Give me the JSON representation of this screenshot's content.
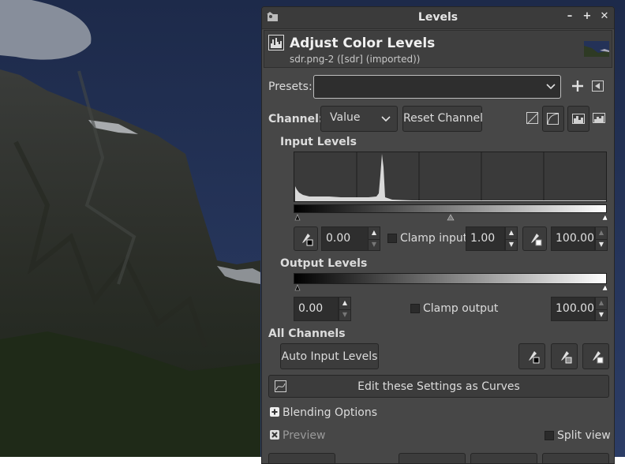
{
  "window": {
    "title": "Levels"
  },
  "header": {
    "title": "Adjust Color Levels",
    "subtitle": "sdr.png-2 ([sdr] (imported))"
  },
  "presets": {
    "label": "Presets:",
    "value": ""
  },
  "channel": {
    "label": "Channel:",
    "value": "Value",
    "reset_label": "Reset Channel"
  },
  "input_levels": {
    "heading": "Input Levels",
    "low": "0.00",
    "clamp_label": "Clamp input",
    "gamma": "1.00",
    "high": "100.00"
  },
  "output_levels": {
    "heading": "Output Levels",
    "low": "0.00",
    "clamp_label": "Clamp output",
    "high": "100.00"
  },
  "all_channels": {
    "heading": "All Channels",
    "auto_label": "Auto Input Levels"
  },
  "curves_button": "Edit these Settings as Curves",
  "blending": {
    "label": "Blending Options"
  },
  "preview": {
    "label": "Preview",
    "checked": true
  },
  "split_view": {
    "label": "Split view",
    "checked": false
  },
  "colors": {
    "dialog_bg": "#474747",
    "field_bg": "#2e2e2e",
    "histogram_fill": "#d9d9d9"
  }
}
